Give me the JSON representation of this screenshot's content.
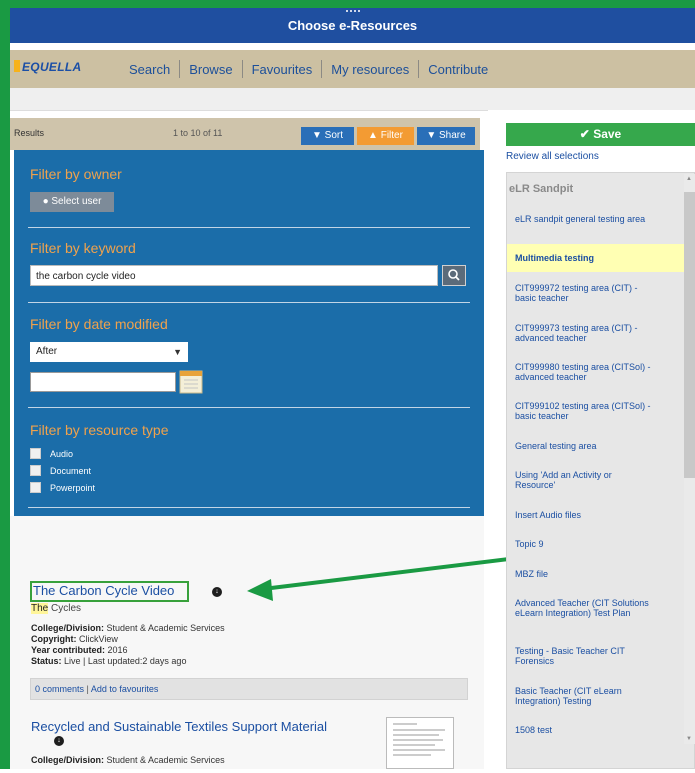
{
  "window": {
    "title": "Choose e-Resources"
  },
  "brand": {
    "logo_text": "EQUELLA"
  },
  "nav": {
    "items": [
      "Search",
      "Browse",
      "Favourites",
      "My resources",
      "Contribute"
    ]
  },
  "results_header": {
    "label": "Results",
    "range": "1 to 10 of 11",
    "sort": "Sort",
    "filter": "Filter",
    "share": "Share"
  },
  "filters": {
    "owner": {
      "title": "Filter by owner",
      "button": "Select user"
    },
    "keyword": {
      "title": "Filter by keyword",
      "value": "the carbon cycle video"
    },
    "date": {
      "title": "Filter by date modified",
      "select": "After",
      "value": ""
    },
    "type": {
      "title": "Filter by resource type",
      "options": [
        "Audio",
        "Document",
        "Powerpoint"
      ]
    }
  },
  "results": [
    {
      "title": "The Carbon Cycle Video",
      "subtitle_highlight": "The",
      "subtitle_rest": " Cycles",
      "meta": [
        {
          "label": "College/Division:",
          "value": " Student & Academic Services"
        },
        {
          "label": "Copyright:",
          "value": " ClickView"
        },
        {
          "label": "Year contributed:",
          "value": " 2016"
        },
        {
          "label": "Status:",
          "value": " Live | Last updated:2 days ago"
        }
      ],
      "comments": "0 comments",
      "favourites": "Add to favourites"
    },
    {
      "title": "Recycled and Sustainable Textiles Support Material",
      "meta": [
        {
          "label": "College/Division:",
          "value": " Student & Academic Services"
        }
      ]
    }
  ],
  "selection": {
    "save": "Save",
    "review": "Review all selections",
    "tree_title": "eLR Sandpit",
    "items": [
      "eLR sandpit general testing area",
      "Multimedia testing",
      "CIT999972 testing area (CIT) - basic teacher",
      "CIT999973 testing area (CIT) - advanced teacher",
      "CIT999980 testing area (CITSol) - advanced teacher",
      "CIT999102 testing area (CITSol) - basic teacher",
      "General testing area",
      "Using 'Add an Activity or Resource'",
      "Insert Audio files",
      "Topic 9",
      "MBZ file",
      "Advanced Teacher (CIT Solutions eLearn Integration) Test Plan",
      "Testing - Basic Teacher CIT Forensics",
      "Basic Teacher (CIT eLearn Integration) Testing",
      "1508 test"
    ],
    "selected_index": 1
  },
  "colors": {
    "title_bar": "#1f4fa0",
    "filter_panel": "#1b6da9",
    "filter_title": "#f0a24c",
    "save": "#36a84c",
    "highlight_frame": "#1a9a43"
  }
}
